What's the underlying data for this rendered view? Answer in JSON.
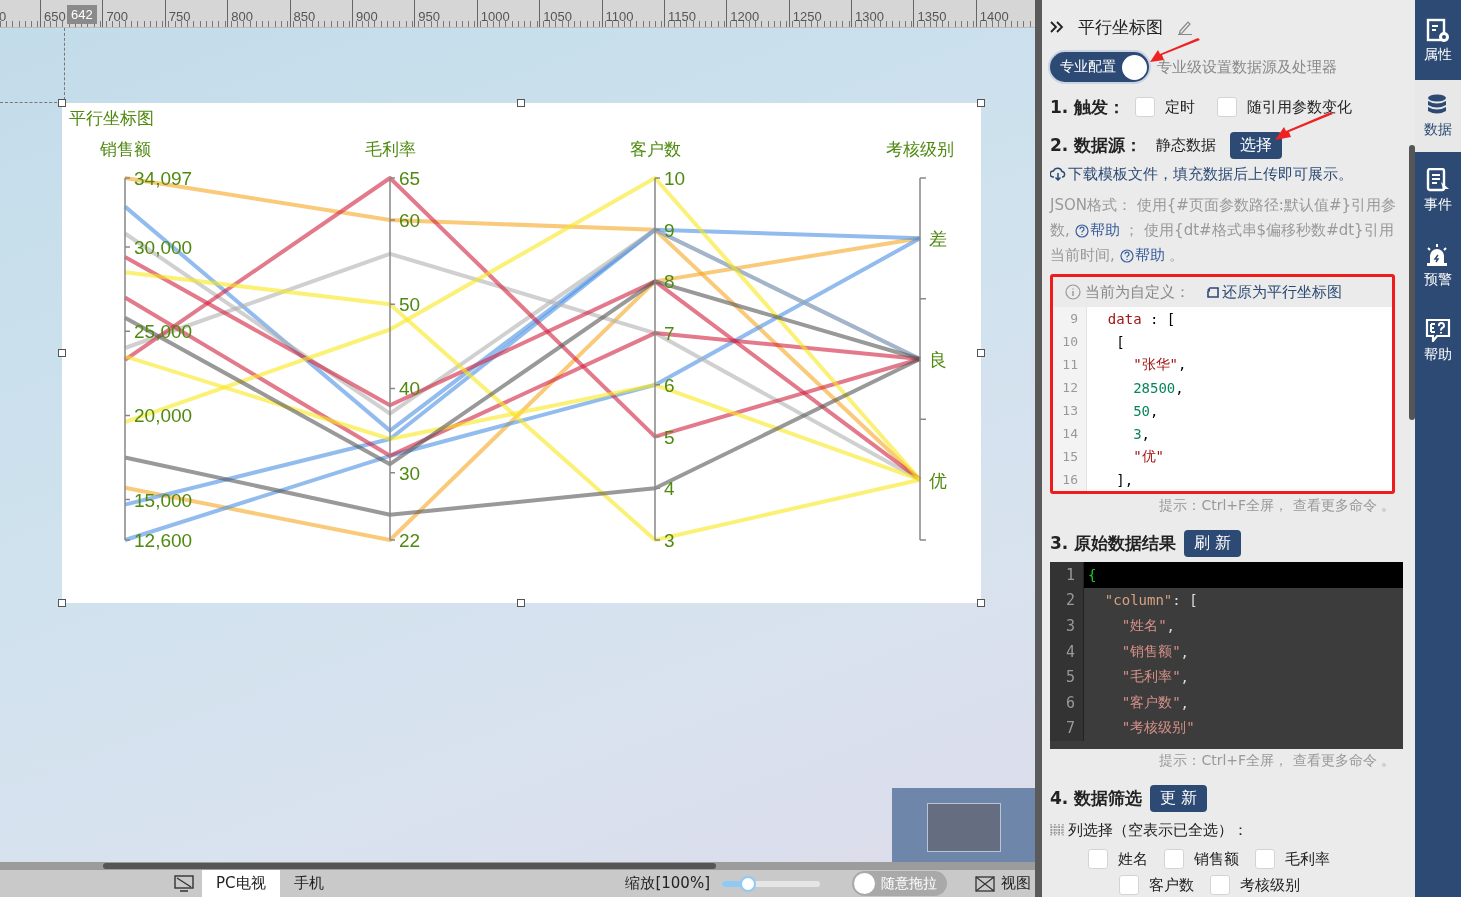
{
  "ruler": {
    "labels": [
      "0",
      "650",
      "700",
      "750",
      "800",
      "850",
      "900",
      "950",
      "1000",
      "1050",
      "1100",
      "1150",
      "1200",
      "1250",
      "1300",
      "1350",
      "1400"
    ],
    "marker": "642"
  },
  "chart_card": {
    "title": "平行坐标图",
    "axes": [
      {
        "label": "销售额",
        "kind": "value",
        "ticks": [
          "34,097",
          "30,000",
          "25,000",
          "20,000",
          "15,000",
          "12,600"
        ]
      },
      {
        "label": "毛利率",
        "kind": "value",
        "ticks": [
          "65",
          "60",
          "50",
          "40",
          "30",
          "22"
        ]
      },
      {
        "label": "客户数",
        "kind": "value",
        "ticks": [
          "10",
          "9",
          "8",
          "7",
          "6",
          "5",
          "4",
          "3"
        ]
      },
      {
        "label": "考核级别",
        "kind": "category",
        "ticks": [
          "差",
          "良",
          "优"
        ]
      }
    ]
  },
  "bottom_bar": {
    "devices": [
      {
        "label": "PC电视",
        "selected": true
      },
      {
        "label": "手机",
        "selected": false
      }
    ],
    "zoom_label": "缩放[100%]",
    "zoom": {
      "level": 0.27
    },
    "drag_toggle": {
      "label": "随意拖拉",
      "on": false
    },
    "view_label": "视图"
  },
  "panel": {
    "title": "平行坐标图",
    "pro_toggle": {
      "label": "专业配置",
      "on": true,
      "description": "专业级设置数据源及处理器"
    },
    "trigger": {
      "label": "1. 触发：",
      "options": [
        {
          "label": "定时",
          "checked": false
        },
        {
          "label": "随引用参数变化",
          "checked": false
        }
      ]
    },
    "datasource": {
      "label": "2. 数据源：",
      "value": "静态数据",
      "button": "选择"
    },
    "download_link": "下载模板文件，填充数据后上传即可展示。",
    "json_help": [
      {
        "kind": "text",
        "text": "JSON格式：  使用{#页面参数路径:默认值#}引用参数, "
      },
      {
        "kind": "link",
        "text": "帮助"
      },
      {
        "kind": "text",
        "text": " ；  使用{dt#格式串$偏移秒数#dt}引用当前时间, "
      },
      {
        "kind": "link",
        "text": "帮助"
      },
      {
        "kind": "text",
        "text": " 。"
      }
    ],
    "custom_notice": {
      "label": "当前为自定义：",
      "restore": "还原为平行坐标图"
    },
    "editor": {
      "lines": [
        {
          "num": "9",
          "tokens": [
            {
              "kind": "key",
              "text": "  data"
            },
            {
              "kind": "punct",
              "text": " : ["
            }
          ]
        },
        {
          "num": "10",
          "tokens": [
            {
              "kind": "punct",
              "text": "   ["
            }
          ]
        },
        {
          "num": "11",
          "tokens": [
            {
              "kind": "string",
              "text": "     \"张华\""
            },
            {
              "kind": "punct",
              "text": ","
            }
          ]
        },
        {
          "num": "12",
          "tokens": [
            {
              "kind": "number",
              "text": "     28500"
            },
            {
              "kind": "punct",
              "text": ","
            }
          ]
        },
        {
          "num": "13",
          "tokens": [
            {
              "kind": "number",
              "text": "     50"
            },
            {
              "kind": "punct",
              "text": ","
            }
          ]
        },
        {
          "num": "14",
          "tokens": [
            {
              "kind": "number",
              "text": "     3"
            },
            {
              "kind": "punct",
              "text": ","
            }
          ]
        },
        {
          "num": "15",
          "tokens": [
            {
              "kind": "string",
              "text": "     \"优\""
            }
          ]
        },
        {
          "num": "16",
          "tokens": [
            {
              "kind": "punct",
              "text": "   ],"
            }
          ]
        }
      ],
      "hint": "提示：Ctrl+F全屏， 查看更多命令 。"
    },
    "result": {
      "label": "3. 原始数据结果",
      "button": "刷 新",
      "lines": [
        {
          "num": "1",
          "current": true,
          "tokens": [
            {
              "kind": "brace",
              "text": "{"
            }
          ]
        },
        {
          "num": "2",
          "current": false,
          "tokens": [
            {
              "kind": "key",
              "text": "  \"column\""
            },
            {
              "kind": "punct",
              "text": ": ["
            }
          ]
        },
        {
          "num": "3",
          "current": false,
          "tokens": [
            {
              "kind": "string",
              "text": "    \"姓名\""
            },
            {
              "kind": "punct",
              "text": ","
            }
          ]
        },
        {
          "num": "4",
          "current": false,
          "tokens": [
            {
              "kind": "string",
              "text": "    \"销售额\""
            },
            {
              "kind": "punct",
              "text": ","
            }
          ]
        },
        {
          "num": "5",
          "current": false,
          "tokens": [
            {
              "kind": "string",
              "text": "    \"毛利率\""
            },
            {
              "kind": "punct",
              "text": ","
            }
          ]
        },
        {
          "num": "6",
          "current": false,
          "tokens": [
            {
              "kind": "string",
              "text": "    \"客户数\""
            },
            {
              "kind": "punct",
              "text": ","
            }
          ]
        },
        {
          "num": "7",
          "current": false,
          "tokens": [
            {
              "kind": "string",
              "text": "    \"考核级别\""
            }
          ]
        }
      ],
      "hint": "提示：Ctrl+F全屏， 查看更多命令 。"
    },
    "filter": {
      "label": "4. 数据筛选",
      "button": "更 新",
      "column_label": "列选择（空表示已全选）：",
      "columns": [
        {
          "label": "姓名",
          "checked": false
        },
        {
          "label": "销售额",
          "checked": false
        },
        {
          "label": "毛利率",
          "checked": false
        },
        {
          "label": "客户数",
          "checked": false
        },
        {
          "label": "考核级别",
          "checked": false
        }
      ]
    }
  },
  "side_nav": [
    {
      "kind": "properties",
      "label": "属性",
      "selected": false
    },
    {
      "kind": "data",
      "label": "数据",
      "selected": true
    },
    {
      "kind": "events",
      "label": "事件",
      "selected": false
    },
    {
      "kind": "alerts",
      "label": "预警",
      "selected": false
    },
    {
      "kind": "help",
      "label": "帮助",
      "selected": false
    }
  ]
}
